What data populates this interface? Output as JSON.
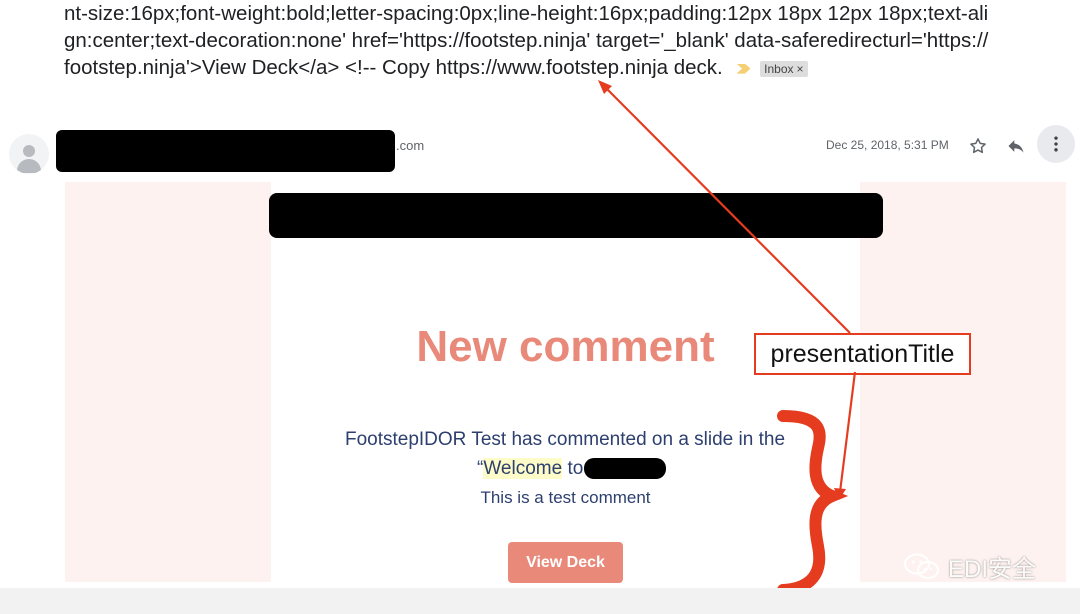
{
  "email": {
    "subject_code": "nt-size:16px;font-weight:bold;letter-spacing:0px;line-height:16px;padding:12px 18px 12px 18px;text-align:center;text-decoration:none' href='https://footstep.ninja' target='_blank' data-saferedirecturl='https://footstep.ninja'>View Deck</a> <!-- Copy https://www.footstep.ninja deck.",
    "label": "Inbox",
    "label_remove": "×",
    "sender_domain": ".com",
    "timestamp": "Dec 25, 2018, 5:31 PM"
  },
  "body": {
    "title": "New comment",
    "line1": "FootstepIDOR Test has commented on a slide in the",
    "quote_open": "“",
    "highlight_word": "Welcome",
    "word_to": " to",
    "comment": "This is a test comment",
    "button_label": "View Deck"
  },
  "annotation": {
    "label": "presentationTitle",
    "color": "#e53c1f"
  },
  "watermark": {
    "text": "EDI安全"
  },
  "colors": {
    "accent": "#e8897a",
    "frame": "#fdf2ef",
    "text_navy": "#2d3f6e"
  },
  "icons": [
    "label-arrow-icon",
    "close-icon",
    "person-icon",
    "star-icon",
    "reply-icon",
    "more-vert-icon",
    "wechat-icon"
  ]
}
